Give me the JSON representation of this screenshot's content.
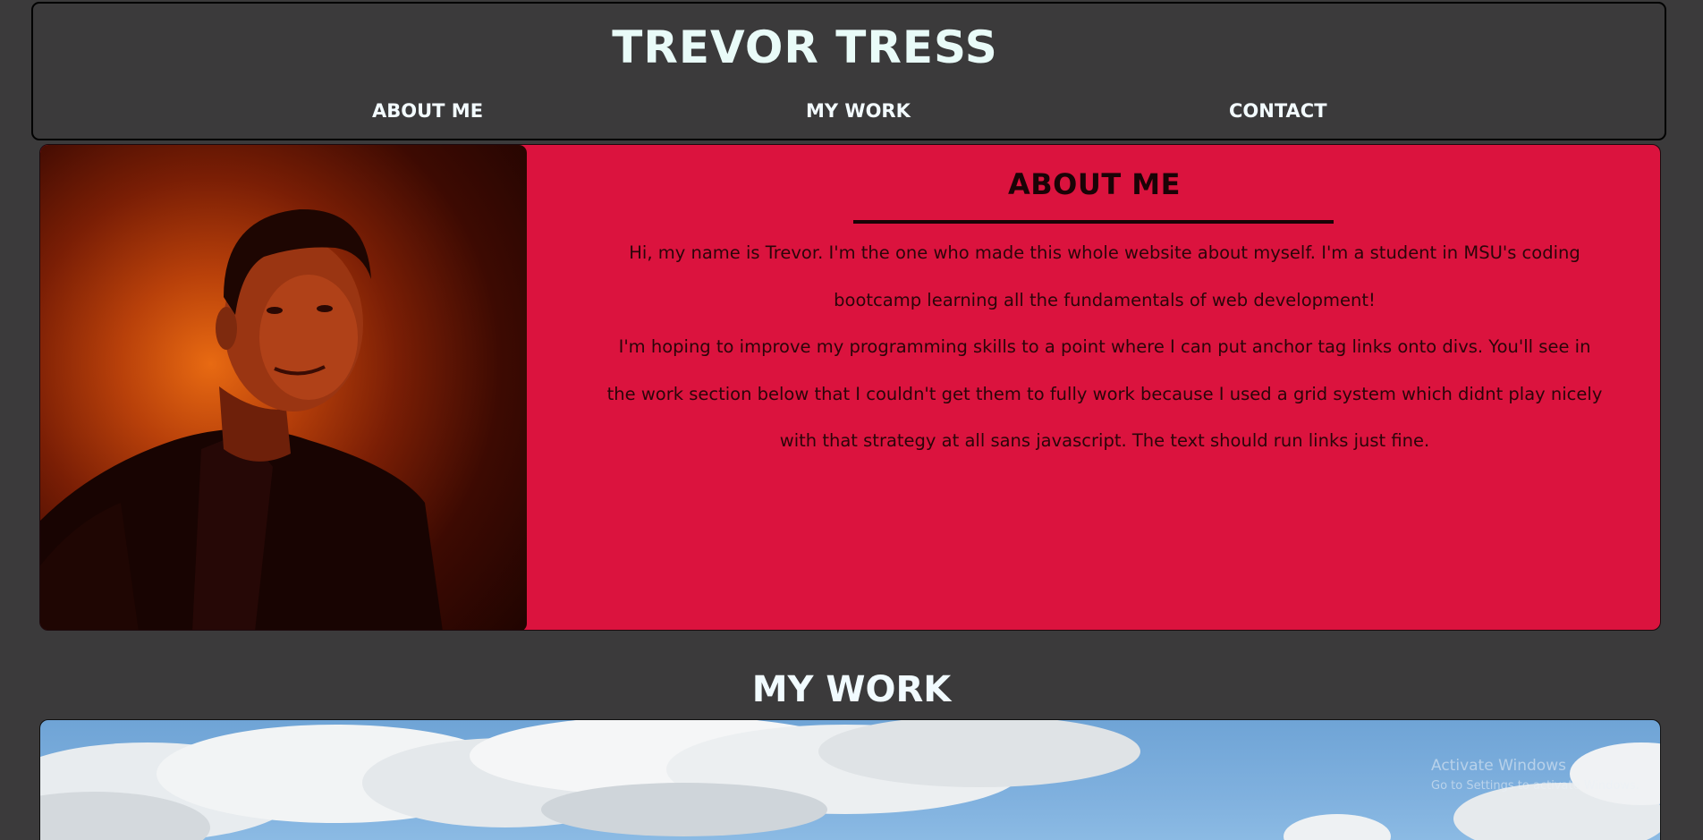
{
  "header": {
    "title": "TREVOR TRESS",
    "nav": [
      {
        "label": "ABOUT ME"
      },
      {
        "label": "MY WORK"
      },
      {
        "label": "CONTACT"
      }
    ]
  },
  "about": {
    "heading": "ABOUT ME",
    "paragraphs": [
      "Hi, my name is Trevor. I'm the one who made this whole website about myself. I'm a student in MSU's coding bootcamp learning all the fundamentals of web development!",
      "I'm hoping to improve my programming skills to a point where I can put anchor tag links onto divs. You'll see in the work section below that I couldn't get them to fully work because I used a grid system which didnt play nicely with that strategy at all sans javascript. The text should run links just fine."
    ]
  },
  "work": {
    "heading": "MY WORK"
  },
  "os_watermark": {
    "title": "Activate Windows",
    "subtitle": "Go to Settings to activate Windows."
  },
  "colors": {
    "page_background": "#3b3a3b",
    "about_background": "#db133e",
    "header_text": "#e9fbf8"
  }
}
